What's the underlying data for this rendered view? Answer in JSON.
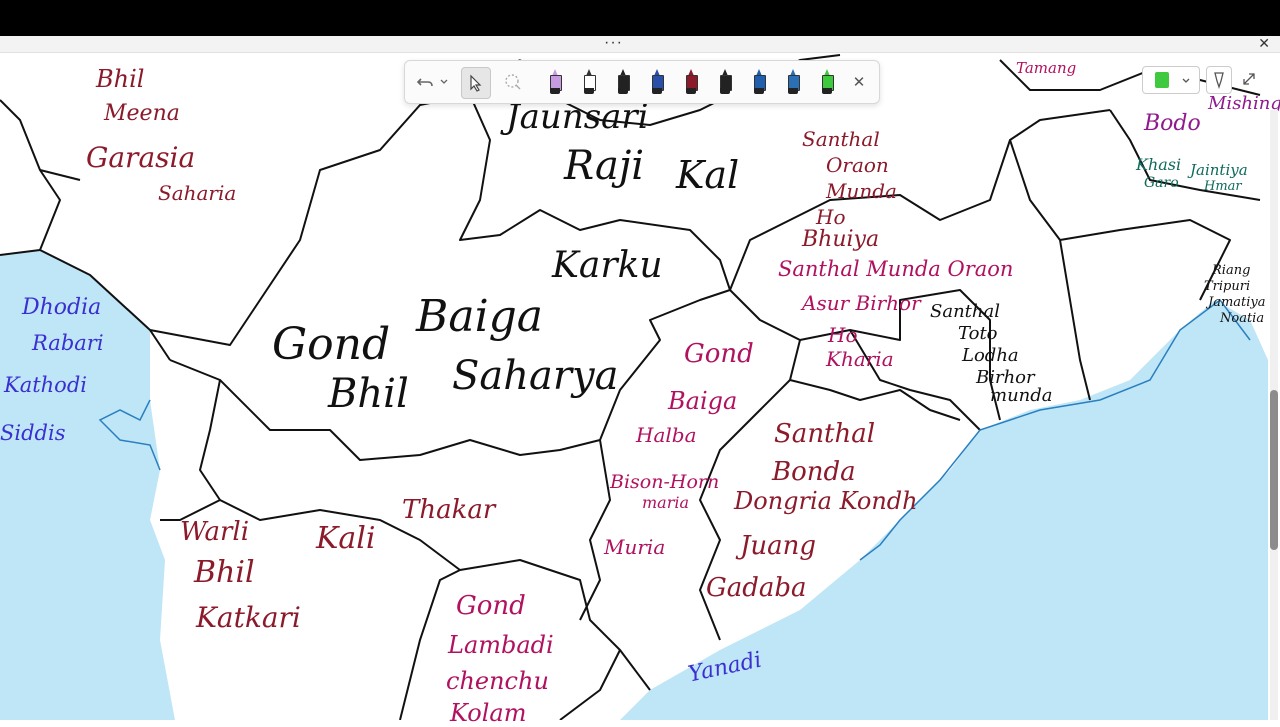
{
  "toolbar": {
    "undo_icon": "undo-icon",
    "dropdown_icon": "chevron-down-icon",
    "select_icon": "pointer-icon",
    "lasso_icon": "lasso-icon",
    "close_symbol": "✕",
    "pens": [
      {
        "name": "highlighter-purple-pen",
        "color": "#c79be0"
      },
      {
        "name": "pen-outline",
        "color": "#ffffff"
      },
      {
        "name": "pen-black",
        "color": "#222222"
      },
      {
        "name": "pen-blue",
        "color": "#2a4fa8"
      },
      {
        "name": "pen-maroon",
        "color": "#8b1a2b"
      },
      {
        "name": "pen-black-2",
        "color": "#222222"
      },
      {
        "name": "pen-blue-2",
        "color": "#1f5fae"
      },
      {
        "name": "pen-blue-3",
        "color": "#2b6fb5"
      },
      {
        "name": "highlighter-green",
        "color": "#3ec93e"
      }
    ]
  },
  "window": {
    "more_symbol": "···",
    "close_symbol": "✕"
  },
  "colors": {
    "sea": "#bfe6f6",
    "maroon": "#8b1a2b",
    "magenta": "#b0125f",
    "black": "#111111",
    "blue": "#3a2fd0",
    "teal": "#0f6b5b"
  },
  "map_labels": {
    "bhil_nw": "Bhil",
    "meena": "Meena",
    "garasia": "Garasia",
    "saharia_nw": "Saharia",
    "dhodia": "Dhodia",
    "rabari": "Rabari",
    "kathodi": "Kathodi",
    "siddis": "Siddis",
    "jaunsari": "Jaunsari",
    "raji": "Raji",
    "kal": "Kal",
    "karku": "Karku",
    "gond_mp": "Gond",
    "baiga_mp": "Baiga",
    "bhil_mp": "Bhil",
    "sahariya": "Saharya",
    "warli": "Warli",
    "bhil_mh": "Bhil",
    "katkari": "Katkari",
    "kali": "Kali",
    "thakar": "Thakar",
    "gond_ap": "Gond",
    "lambadi": "Lambadi",
    "chenchu": "chenchu",
    "kolam": "Kolam",
    "gond_cg": "Gond",
    "baiga_cg": "Baiga",
    "halba": "Halba",
    "bison_horn": "Bison-Horn",
    "maria": "maria",
    "muria": "Muria",
    "santhal_od": "Santhal",
    "bonda": "Bonda",
    "dongria": "Dongria Kondh",
    "juang": "Juang",
    "gadaba": "Gadaba",
    "yanadi": "Yanadi",
    "santhal_bh": "Santhal",
    "oraon_bh": "Oraon",
    "munda_bh": "Munda",
    "ho_bh": "Ho",
    "bhuiya": "Bhuiya",
    "santhal_jh": "Santhal Munda Oraon",
    "asur": "Asur Birhor",
    "ho_jh": "Ho",
    "kharia": "Kharia",
    "santhal_wb": "Santhal",
    "toto": "Toto",
    "lodha": "Lodha",
    "birhor_wb": "Birhor",
    "munda_wb": "munda",
    "tamang": "Tamang",
    "bodo": "Bodo",
    "mishing": "Mishing",
    "khasi": "Khasi",
    "garo": "Garo",
    "jaintiya": "Jaintiya",
    "hmar": "Hmar",
    "riang": "Riang",
    "tripuri": "Tripuri",
    "jamatiya": "Jamatiya",
    "noatia": "Noatia"
  }
}
